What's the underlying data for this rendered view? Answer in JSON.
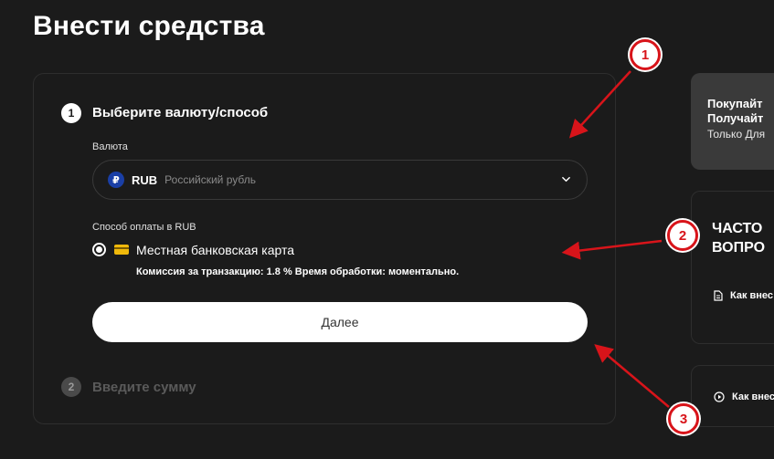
{
  "page": {
    "title": "Внести средства"
  },
  "step1": {
    "number": "1",
    "title": "Выберите валюту/способ",
    "currency_label": "Валюта",
    "currency": {
      "symbol": "₽",
      "code": "RUB",
      "name": "Российский рубль"
    },
    "method_label": "Способ оплаты в RUB",
    "method": {
      "name": "Местная банковская карта",
      "info": "Комиссия за транзакцию: 1.8 % Время обработки: моментально.",
      "selected": true
    },
    "next_label": "Далее"
  },
  "step2": {
    "number": "2",
    "title": "Введите сумму"
  },
  "promo": {
    "line1": "Покупайт",
    "line2": "Получайт",
    "sub": "Только Для"
  },
  "faq": {
    "title": "ЧАСТО\nВОПРО",
    "link": "Как внес"
  },
  "video": {
    "link": "Как внес"
  },
  "annotations": [
    {
      "label": "1"
    },
    {
      "label": "2"
    },
    {
      "label": "3"
    }
  ],
  "colors": {
    "accent_red": "#d8141a",
    "card_yellow": "#f0b90b",
    "rub_blue": "#1a3fa6",
    "background": "#1b1b1b"
  }
}
